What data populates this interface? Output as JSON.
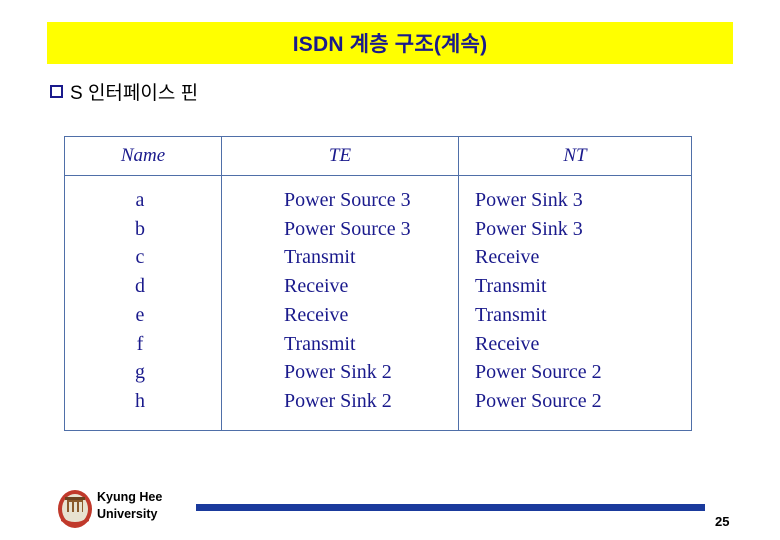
{
  "slide": {
    "title": "ISDN 계층 구조(계속)",
    "bullet": "S 인터페이스 핀",
    "page_number": "25"
  },
  "table": {
    "headers": [
      "Name",
      "TE",
      "NT"
    ],
    "rows": [
      {
        "name": "a",
        "te": "Power Source 3",
        "nt": "Power Sink 3"
      },
      {
        "name": "b",
        "te": "Power Source 3",
        "nt": "Power Sink 3"
      },
      {
        "name": "c",
        "te": "Transmit",
        "nt": "Receive"
      },
      {
        "name": "d",
        "te": "Receive",
        "nt": "Transmit"
      },
      {
        "name": "e",
        "te": "Receive",
        "nt": "Transmit"
      },
      {
        "name": "f",
        "te": "Transmit",
        "nt": "Receive"
      },
      {
        "name": "g",
        "te": "Power Sink 2",
        "nt": "Power Source 2"
      },
      {
        "name": "h",
        "te": "Power Sink 2",
        "nt": "Power Source 2"
      }
    ]
  },
  "footer": {
    "org_line1": "Kyung Hee",
    "org_line2": "University"
  },
  "colors": {
    "title_bg": "#ffff00",
    "title_text": "#1a1a8c",
    "table_text": "#1a1a8c",
    "table_border": "#4f6fa8",
    "rule": "#1a3a9c"
  }
}
